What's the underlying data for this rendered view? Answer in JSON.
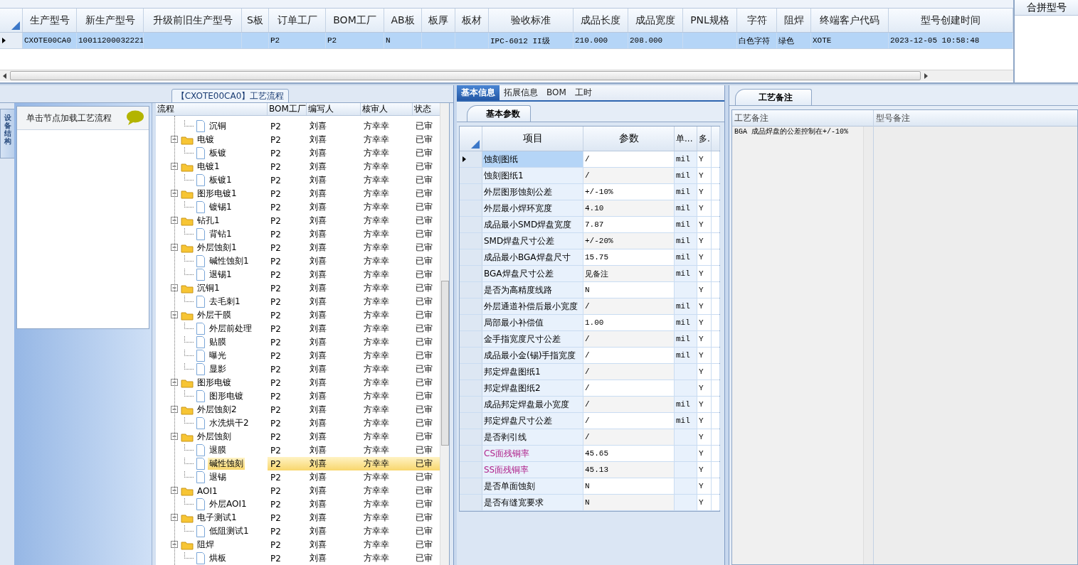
{
  "models": {
    "columns": [
      "生产型号",
      "新生产型号",
      "升级前旧生产型号",
      "S板",
      "订单工厂",
      "BOM工厂",
      "AB板",
      "板厚",
      "板材",
      "验收标准",
      "成品长度",
      "成品宽度",
      "PNL规格",
      "字符",
      "阻焊",
      "终端客户代码",
      "型号创建时间"
    ],
    "rows": [
      {
        "selected": true,
        "cells": [
          "CXOTE00CA0",
          "10011200032221",
          null,
          null,
          "P2",
          "P2",
          "N",
          null,
          null,
          "IPC-6012 II级",
          "210.000",
          "208.000",
          null,
          "白色字符",
          "绿色",
          "XOTE",
          "2023-12-05 10:58:48"
        ]
      }
    ]
  },
  "merge_panel": {
    "title": "合拼型号"
  },
  "left": {
    "group_title": "【CXOTE00CA0】工艺流程",
    "side_tab": "设备结构",
    "hint": "单击节点加载工艺流程"
  },
  "process": {
    "columns": [
      "流程",
      "BOM工厂",
      "编写人",
      "核审人",
      "状态"
    ],
    "nodes": [
      {
        "label": "沉铜",
        "kind": "leaf",
        "bom": "P2",
        "writer": "刘喜",
        "reviewer": "方幸幸",
        "status": "已审",
        "selected": false
      },
      {
        "label": "电镀",
        "kind": "folder",
        "expanded": true,
        "bom": "P2",
        "writer": "刘喜",
        "reviewer": "方幸幸",
        "status": "已审",
        "selected": false,
        "children": [
          {
            "label": "板镀",
            "kind": "leaf",
            "bom": "P2",
            "writer": "刘喜",
            "reviewer": "方幸幸",
            "status": "已审",
            "selected": false
          }
        ]
      },
      {
        "label": "电镀1",
        "kind": "folder",
        "expanded": true,
        "bom": "P2",
        "writer": "刘喜",
        "reviewer": "方幸幸",
        "status": "已审",
        "selected": false,
        "children": [
          {
            "label": "板镀1",
            "kind": "leaf",
            "bom": "P2",
            "writer": "刘喜",
            "reviewer": "方幸幸",
            "status": "已审",
            "selected": false
          }
        ]
      },
      {
        "label": "图形电镀1",
        "kind": "folder",
        "expanded": true,
        "bom": "P2",
        "writer": "刘喜",
        "reviewer": "方幸幸",
        "status": "已审",
        "selected": false,
        "children": [
          {
            "label": "镀锡1",
            "kind": "leaf",
            "bom": "P2",
            "writer": "刘喜",
            "reviewer": "方幸幸",
            "status": "已审",
            "selected": false
          }
        ]
      },
      {
        "label": "钻孔1",
        "kind": "folder",
        "expanded": true,
        "bom": "P2",
        "writer": "刘喜",
        "reviewer": "方幸幸",
        "status": "已审",
        "selected": false,
        "children": [
          {
            "label": "背钻1",
            "kind": "leaf",
            "bom": "P2",
            "writer": "刘喜",
            "reviewer": "方幸幸",
            "status": "已审",
            "selected": false
          }
        ]
      },
      {
        "label": "外层蚀刻1",
        "kind": "folder",
        "expanded": true,
        "bom": "P2",
        "writer": "刘喜",
        "reviewer": "方幸幸",
        "status": "已审",
        "selected": false,
        "children": [
          {
            "label": "碱性蚀刻1",
            "kind": "leaf",
            "bom": "P2",
            "writer": "刘喜",
            "reviewer": "方幸幸",
            "status": "已审",
            "selected": false
          },
          {
            "label": "退锡1",
            "kind": "leaf",
            "bom": "P2",
            "writer": "刘喜",
            "reviewer": "方幸幸",
            "status": "已审",
            "selected": false
          }
        ]
      },
      {
        "label": "沉铜1",
        "kind": "folder",
        "expanded": true,
        "bom": "P2",
        "writer": "刘喜",
        "reviewer": "方幸幸",
        "status": "已审",
        "selected": false,
        "children": [
          {
            "label": "去毛刺1",
            "kind": "leaf",
            "bom": "P2",
            "writer": "刘喜",
            "reviewer": "方幸幸",
            "status": "已审",
            "selected": false
          }
        ]
      },
      {
        "label": "外层干膜",
        "kind": "folder",
        "expanded": true,
        "bom": "P2",
        "writer": "刘喜",
        "reviewer": "方幸幸",
        "status": "已审",
        "selected": false,
        "children": [
          {
            "label": "外层前处理",
            "kind": "leaf",
            "bom": "P2",
            "writer": "刘喜",
            "reviewer": "方幸幸",
            "status": "已审",
            "selected": false
          },
          {
            "label": "贴膜",
            "kind": "leaf",
            "bom": "P2",
            "writer": "刘喜",
            "reviewer": "方幸幸",
            "status": "已审",
            "selected": false
          },
          {
            "label": "曝光",
            "kind": "leaf",
            "bom": "P2",
            "writer": "刘喜",
            "reviewer": "方幸幸",
            "status": "已审",
            "selected": false
          },
          {
            "label": "显影",
            "kind": "leaf",
            "bom": "P2",
            "writer": "刘喜",
            "reviewer": "方幸幸",
            "status": "已审",
            "selected": false
          }
        ]
      },
      {
        "label": "图形电镀",
        "kind": "folder",
        "expanded": true,
        "bom": "P2",
        "writer": "刘喜",
        "reviewer": "方幸幸",
        "status": "已审",
        "selected": false,
        "children": [
          {
            "label": "图形电镀",
            "kind": "leaf",
            "bom": "P2",
            "writer": "刘喜",
            "reviewer": "方幸幸",
            "status": "已审",
            "selected": false
          }
        ]
      },
      {
        "label": "外层蚀刻2",
        "kind": "folder",
        "expanded": true,
        "bom": "P2",
        "writer": "刘喜",
        "reviewer": "方幸幸",
        "status": "已审",
        "selected": false,
        "children": [
          {
            "label": "水洗烘干2",
            "kind": "leaf",
            "bom": "P2",
            "writer": "刘喜",
            "reviewer": "方幸幸",
            "status": "已审",
            "selected": false
          }
        ]
      },
      {
        "label": "外层蚀刻",
        "kind": "folder",
        "expanded": true,
        "bom": "P2",
        "writer": "刘喜",
        "reviewer": "方幸幸",
        "status": "已审",
        "selected": false,
        "children": [
          {
            "label": "退膜",
            "kind": "leaf",
            "bom": "P2",
            "writer": "刘喜",
            "reviewer": "方幸幸",
            "status": "已审",
            "selected": false
          },
          {
            "label": "碱性蚀刻",
            "kind": "leaf",
            "bom": "P2",
            "writer": "刘喜",
            "reviewer": "方幸幸",
            "status": "已审",
            "selected": true
          },
          {
            "label": "退锡",
            "kind": "leaf",
            "bom": "P2",
            "writer": "刘喜",
            "reviewer": "方幸幸",
            "status": "已审",
            "selected": false
          }
        ]
      },
      {
        "label": "AOI1",
        "kind": "folder",
        "expanded": true,
        "bom": "P2",
        "writer": "刘喜",
        "reviewer": "方幸幸",
        "status": "已审",
        "selected": false,
        "children": [
          {
            "label": "外层AOI1",
            "kind": "leaf",
            "bom": "P2",
            "writer": "刘喜",
            "reviewer": "方幸幸",
            "status": "已审",
            "selected": false
          }
        ]
      },
      {
        "label": "电子测试1",
        "kind": "folder",
        "expanded": true,
        "bom": "P2",
        "writer": "刘喜",
        "reviewer": "方幸幸",
        "status": "已审",
        "selected": false,
        "children": [
          {
            "label": "低阻测试1",
            "kind": "leaf",
            "bom": "P2",
            "writer": "刘喜",
            "reviewer": "方幸幸",
            "status": "已审",
            "selected": false
          }
        ]
      },
      {
        "label": "阻焊",
        "kind": "folder",
        "expanded": true,
        "bom": "P2",
        "writer": "刘喜",
        "reviewer": "方幸幸",
        "status": "已审",
        "selected": false,
        "children": [
          {
            "label": "烘板",
            "kind": "leaf",
            "bom": "P2",
            "writer": "刘喜",
            "reviewer": "方幸幸",
            "status": "已审",
            "selected": false
          }
        ]
      }
    ]
  },
  "params": {
    "tabs": [
      {
        "label": "基本信息",
        "selected": true
      },
      {
        "label": "拓展信息",
        "selected": false
      },
      {
        "label": "BOM",
        "selected": false
      },
      {
        "label": "工时",
        "selected": false
      }
    ],
    "subtab": "基本参数",
    "columns": [
      "项目",
      "参数",
      "单...",
      "多.."
    ],
    "rows": [
      {
        "item": "蚀刻图纸",
        "value": "/",
        "unit": "mil",
        "flag": "Y",
        "kind": "normal",
        "selected": true
      },
      {
        "item": "蚀刻图纸1",
        "value": "/",
        "unit": "mil",
        "flag": "Y",
        "kind": "normal",
        "selected": false
      },
      {
        "item": "外层图形蚀刻公差",
        "value": "+/-10%",
        "unit": "mil",
        "flag": "Y",
        "kind": "normal",
        "selected": false
      },
      {
        "item": "外层最小焊环宽度",
        "value": "4.10",
        "unit": "mil",
        "flag": "Y",
        "kind": "normal",
        "selected": false
      },
      {
        "item": "成品最小SMD焊盘宽度",
        "value": "7.87",
        "unit": "mil",
        "flag": "Y",
        "kind": "normal",
        "selected": false
      },
      {
        "item": "SMD焊盘尺寸公差",
        "value": "+/-20%",
        "unit": "mil",
        "flag": "Y",
        "kind": "normal",
        "selected": false
      },
      {
        "item": "成品最小BGA焊盘尺寸",
        "value": "15.75",
        "unit": "mil",
        "flag": "Y",
        "kind": "normal",
        "selected": false
      },
      {
        "item": "BGA焊盘尺寸公差",
        "value": "见备注",
        "unit": "mil",
        "flag": "Y",
        "kind": "normal",
        "selected": false
      },
      {
        "item": "是否为高精度线路",
        "value": "N",
        "flag": "Y",
        "kind": "normal",
        "selected": false
      },
      {
        "item": "外层通道补偿后最小宽度",
        "value": "/",
        "unit": "mil",
        "flag": "Y",
        "kind": "normal",
        "selected": false
      },
      {
        "item": "局部最小补偿值",
        "value": "1.00",
        "unit": "mil",
        "flag": "Y",
        "kind": "normal",
        "selected": false
      },
      {
        "item": "金手指宽度尺寸公差",
        "value": "/",
        "unit": "mil",
        "flag": "Y",
        "kind": "normal",
        "selected": false
      },
      {
        "item": "成品最小金(锡)手指宽度",
        "value": "/",
        "unit": "mil",
        "flag": "Y",
        "kind": "normal",
        "selected": false
      },
      {
        "item": "邦定焊盘图纸1",
        "value": "/",
        "flag": "Y",
        "kind": "normal",
        "selected": false
      },
      {
        "item": "邦定焊盘图纸2",
        "value": "/",
        "flag": "Y",
        "kind": "normal",
        "selected": false
      },
      {
        "item": "成品邦定焊盘最小宽度",
        "value": "/",
        "unit": "mil",
        "flag": "Y",
        "kind": "normal",
        "selected": false
      },
      {
        "item": "邦定焊盘尺寸公差",
        "value": "/",
        "unit": "mil",
        "flag": "Y",
        "kind": "normal",
        "selected": false
      },
      {
        "item": "是否剥引线",
        "value": "/",
        "flag": "Y",
        "kind": "normal",
        "selected": false
      },
      {
        "item": "CS面残铜率",
        "value": "45.65",
        "flag": "Y",
        "kind": "flagged",
        "selected": false
      },
      {
        "item": "SS面残铜率",
        "value": "45.13",
        "flag": "Y",
        "kind": "flagged",
        "selected": false
      },
      {
        "item": "是否单面蚀刻",
        "value": "N",
        "flag": "Y",
        "kind": "normal",
        "selected": false
      },
      {
        "item": "是否有缝宽要求",
        "value": "N",
        "flag": "Y",
        "kind": "normal",
        "selected": false
      }
    ]
  },
  "notes": {
    "tab": "工艺备注",
    "columns": [
      "工艺备注",
      "型号备注"
    ],
    "text": "BGA 成品焊盘的公差控制在+/-10%"
  }
}
